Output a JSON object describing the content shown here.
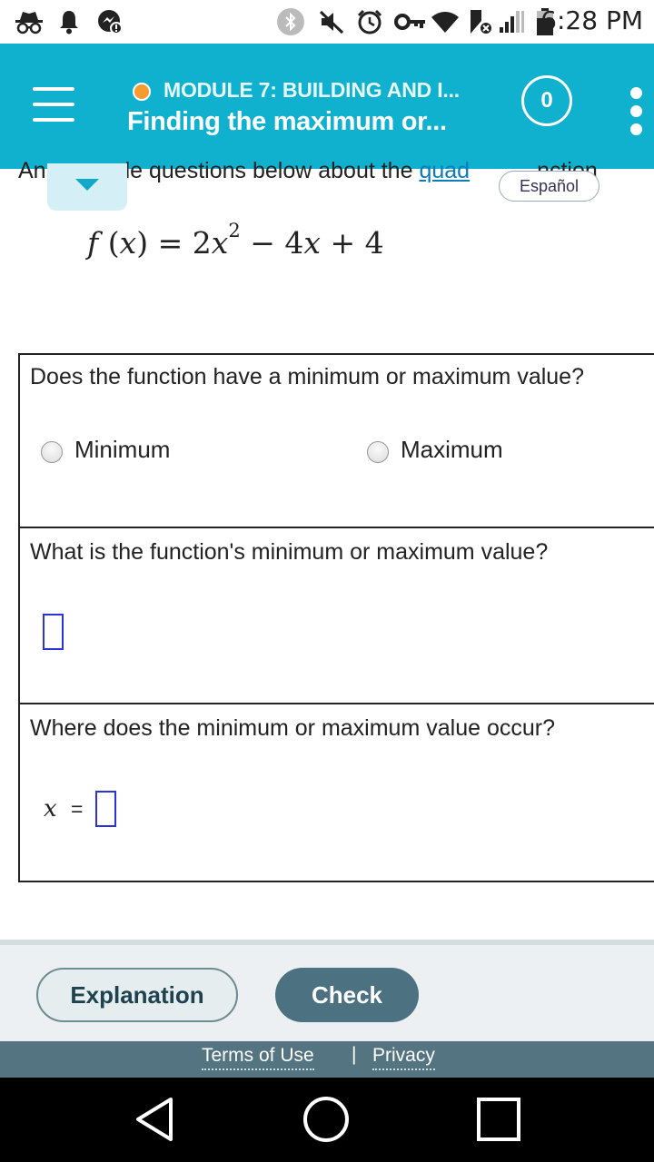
{
  "status_bar": {
    "time": "6:28 PM",
    "icons": [
      "incognito-icon",
      "notification-bell-icon",
      "messenger-icon",
      "bluetooth-icon",
      "mute-icon",
      "alarm-icon",
      "vpn-key-icon",
      "wifi-icon",
      "data-saver-icon",
      "cell-signal-icon",
      "battery-icon"
    ]
  },
  "header": {
    "module_title": "MODULE 7: BUILDING AND I...",
    "page_title": "Finding the maximum or...",
    "score": "0",
    "module_dot_color": "#f79b2e",
    "bg_color": "#10b1cf"
  },
  "intro": {
    "text_before": "An",
    "text_middle": "le questions below about the",
    "link_text": "quad",
    "text_after": "nction"
  },
  "espanol_label": "Español",
  "function": {
    "lhs_f": "f",
    "lhs_x": "x",
    "coef": "2",
    "var": "x",
    "exponent": "2",
    "middle": " − 4",
    "var2": "x",
    "tail": " + 4"
  },
  "questions": {
    "q1": "Does the function have a minimum or maximum value?",
    "q2": "What is the function's minimum or maximum value?",
    "q3": "Where does the minimum or maximum value occur?"
  },
  "options": {
    "minimum": "Minimum",
    "maximum": "Maximum"
  },
  "answer_x_label": "x",
  "answer_eq": "=",
  "buttons": {
    "explanation": "Explanation",
    "check": "Check"
  },
  "legal": {
    "terms": "Terms of Use",
    "separator": "|",
    "privacy": "Privacy"
  }
}
